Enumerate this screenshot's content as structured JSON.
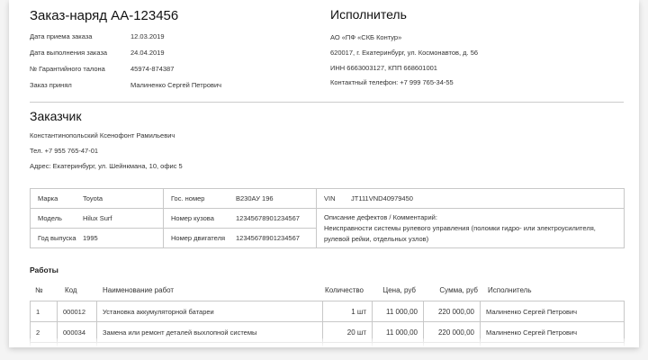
{
  "order": {
    "title": "Заказ-наряд АА-123456",
    "fields": [
      {
        "label": "Дата приема заказа",
        "value": "12.03.2019"
      },
      {
        "label": "Дата выполнения заказа",
        "value": "24.04.2019"
      },
      {
        "label": "№ Гарантийного талона",
        "value": "45974-874387"
      },
      {
        "label": "Заказ принял",
        "value": "Малиненко Сергей Петрович"
      }
    ]
  },
  "contractor": {
    "title": "Исполнитель",
    "lines": [
      "АО «ПФ «СКБ Контур»",
      "620017, г. Екатеринбург, ул. Космонавтов, д. 56",
      "ИНН 6663003127, КПП 668601001",
      "Контактный телефон: +7 999 765-34-55"
    ]
  },
  "customer": {
    "title": "Заказчик",
    "name": "Константинопольский Ксенофонт Рамильевич",
    "phone": "Тел. +7 955 765-47-01",
    "address": "Адрес:  Екатеринбург, ул. Шейнкмана, 10, офис 5"
  },
  "vehicle": {
    "make_label": "Марка",
    "make": "Toyota",
    "model_label": "Модель",
    "model": "Hilux Surf",
    "year_label": "Год выпуска",
    "year": "1995",
    "plate_label": "Гос. номер",
    "plate": "В230АУ 196",
    "body_label": "Номер кузова",
    "body": "12345678901234567",
    "engine_label": "Номер двигателя",
    "engine": "12345678901234567",
    "vin_label": "VIN",
    "vin": "JT111VND40979450",
    "defects_label": "Описание дефектов / Комментарий:",
    "defects": "Неисправности системы рулевого управления (поломки гидро- или электроусилителя, рулевой рейки, отдельных узлов)"
  },
  "works": {
    "title": "Работы",
    "headers": [
      "№",
      "Код",
      "Наименование работ",
      "Количество",
      "Цена, руб",
      "Сумма, руб",
      "Исполнитель"
    ],
    "rows": [
      [
        "1",
        "000012",
        "Установка аккумуляторной батареи",
        "1 шт",
        "11 000,00",
        "220 000,00",
        "Малиненко Сергей Петрович"
      ],
      [
        "2",
        "000034",
        "Замена или ремонт деталей выхлопной системы",
        "20 шт",
        "11 000,00",
        "220 000,00",
        "Малиненко Сергей Петрович"
      ]
    ]
  }
}
